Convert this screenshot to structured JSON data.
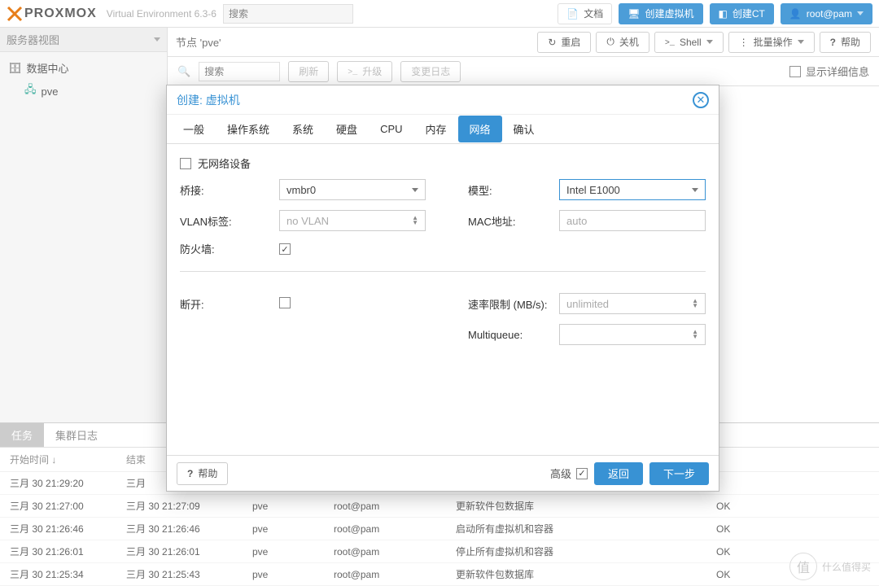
{
  "header": {
    "brand": "PROXMOX",
    "env": "Virtual Environment 6.3-6",
    "search_placeholder": "搜索",
    "docs": "文档",
    "create_vm": "创建虚拟机",
    "create_ct": "创建CT",
    "user": "root@pam"
  },
  "sidebar": {
    "view_label": "服务器视图",
    "root": "数据中心",
    "node": "pve"
  },
  "content": {
    "crumb": "节点 'pve'",
    "btn_reboot": "重启",
    "btn_shutdown": "关机",
    "btn_shell": "Shell",
    "btn_bulk": "批量操作",
    "btn_help": "帮助",
    "search_placeholder": "搜索",
    "btn_refresh": "刷新",
    "btn_upgrade": "升级",
    "btn_changelog": "变更日志",
    "show_details": "显示详细信息"
  },
  "modal": {
    "title": "创建: 虚拟机",
    "tabs": [
      "一般",
      "操作系统",
      "系统",
      "硬盘",
      "CPU",
      "内存",
      "网络",
      "确认"
    ],
    "active_tab": "网络",
    "no_net": "无网络设备",
    "bridge_label": "桥接:",
    "bridge_value": "vmbr0",
    "vlan_label": "VLAN标签:",
    "vlan_value": "no VLAN",
    "fw_label": "防火墙:",
    "fw_checked": true,
    "model_label": "模型:",
    "model_value": "Intel E1000",
    "mac_label": "MAC地址:",
    "mac_value": "auto",
    "disconnect_label": "断开:",
    "rate_label": "速率限制 (MB/s):",
    "rate_value": "unlimited",
    "mq_label": "Multiqueue:",
    "mq_value": "",
    "help": "帮助",
    "advanced": "高级",
    "back": "返回",
    "next": "下一步"
  },
  "tasks": {
    "tab_tasks": "任务",
    "tab_cluster": "集群日志",
    "col_start": "开始时间 ↓",
    "col_end": "结束",
    "rows": [
      {
        "start": "三月 30 21:29:20",
        "end": "三月",
        "node": "",
        "user": "",
        "desc": "",
        "stat": ""
      },
      {
        "start": "三月 30 21:27:00",
        "end": "三月 30 21:27:09",
        "node": "pve",
        "user": "root@pam",
        "desc": "更新软件包数据库",
        "stat": "OK"
      },
      {
        "start": "三月 30 21:26:46",
        "end": "三月 30 21:26:46",
        "node": "pve",
        "user": "root@pam",
        "desc": "启动所有虚拟机和容器",
        "stat": "OK"
      },
      {
        "start": "三月 30 21:26:01",
        "end": "三月 30 21:26:01",
        "node": "pve",
        "user": "root@pam",
        "desc": "停止所有虚拟机和容器",
        "stat": "OK"
      },
      {
        "start": "三月 30 21:25:34",
        "end": "三月 30 21:25:43",
        "node": "pve",
        "user": "root@pam",
        "desc": "更新软件包数据库",
        "stat": "OK"
      }
    ]
  },
  "watermark": "什么值得买"
}
